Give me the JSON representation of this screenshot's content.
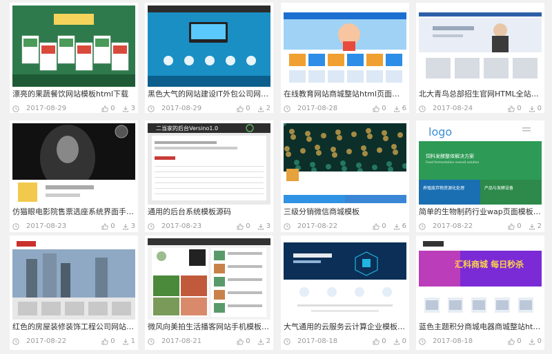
{
  "cards": [
    {
      "title": "漂亮的果蔬餐饮网站模板html下载",
      "date": "2017-08-29",
      "likes": "0",
      "downloads": "3",
      "palette": [
        "#2f7a4c",
        "#1e5a36",
        "#ffffff",
        "#d94a3c"
      ]
    },
    {
      "title": "黑色大气的网站建设IT外包公司网站模板...",
      "date": "2017-08-29",
      "likes": "0",
      "downloads": "2",
      "palette": [
        "#1a8fc4",
        "#0c5f8c",
        "#ffffff",
        "#2c2c2c"
      ]
    },
    {
      "title": "在线教育网站商城整站html页面模板",
      "date": "2017-08-28",
      "likes": "0",
      "downloads": "6",
      "palette": [
        "#1d6fd1",
        "#f3f6fb",
        "#2c8ee6",
        "#e84b3c"
      ]
    },
    {
      "title": "北大青鸟总部招生官网HTML全站模板",
      "date": "2017-08-24",
      "likes": "0",
      "downloads": "0",
      "palette": [
        "#2c5fa8",
        "#e9eef6",
        "#ffffff",
        "#d7dce3"
      ]
    },
    {
      "title": "仿猫眼电影院售票选座系统界面手机模板",
      "date": "2017-08-23",
      "likes": "0",
      "downloads": "3",
      "palette": [
        "#333333",
        "#111111",
        "#888888",
        "#f2c94c"
      ]
    },
    {
      "title": "通用的后台系统模板源码",
      "date": "2017-08-23",
      "likes": "0",
      "downloads": "3",
      "palette": [
        "#2d2d2d",
        "#ffffff",
        "#c83a3a",
        "#e9e9e9"
      ]
    },
    {
      "title": "三级分销微信商城模板",
      "date": "2017-08-22",
      "likes": "0",
      "downloads": "6",
      "palette": [
        "#1e6b55",
        "#0c2f2a",
        "#2f92e3",
        "#ffffff"
      ]
    },
    {
      "title": "简单的生物制药行业wap页面模板整站",
      "date": "2017-08-22",
      "likes": "0",
      "downloads": "2",
      "palette": [
        "#ffffff",
        "#2d9a55",
        "#1a6fb3",
        "#3a8fd6"
      ]
    },
    {
      "title": "红色的房屋装修装饰工程公司网站模板ht...",
      "date": "2017-08-22",
      "likes": "0",
      "downloads": "1",
      "palette": [
        "#c9302c",
        "#8fa9c4",
        "#5a6b7a",
        "#e7e7e7"
      ]
    },
    {
      "title": "微风向美拍生活播客网站手机模板下载",
      "date": "2017-08-21",
      "likes": "0",
      "downloads": "2",
      "palette": [
        "#333333",
        "#ffffff",
        "#4a8a3a",
        "#c05a3a"
      ]
    },
    {
      "title": "大气通用的云服务云计算企业模板html源...",
      "date": "2017-08-18",
      "likes": "0",
      "downloads": "0",
      "palette": [
        "#0b2f57",
        "#1d7ac4",
        "#ffffff",
        "#21b5e0"
      ]
    },
    {
      "title": "蓝色主题积分商城电器商城整站html页面...",
      "date": "2017-08-18",
      "likes": "0",
      "downloads": "0",
      "palette": [
        "#7b2bd6",
        "#e64aa7",
        "#ffd34a",
        "#ffffff"
      ]
    }
  ],
  "thumb_texts": {
    "c6_title": "二当家的后台Versino1.0",
    "c8_logo": "logo",
    "c8_banner": "饲料发酵整体解决方案",
    "c8_banner_sub": "Feed fermentation overall solution",
    "c8_tile1": "养殖废弃物资源化处理",
    "c8_tile2": "产品与发酵设备",
    "c12_banner": "汇科商城 每日秒杀"
  }
}
